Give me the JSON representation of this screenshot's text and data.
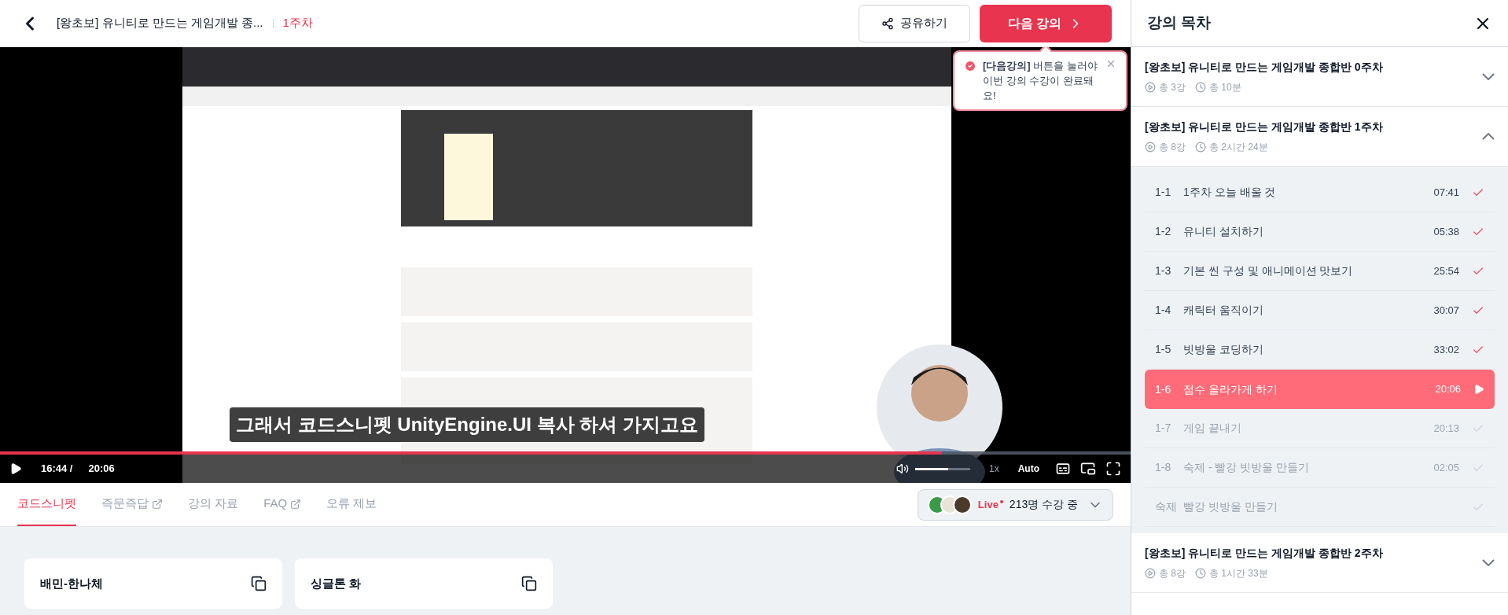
{
  "header": {
    "course_title": "[왕초보] 유니티로 만드는 게임개발 종...",
    "week": "1주차",
    "share_button": "공유하기",
    "next_button": "다음 강의"
  },
  "tooltip": {
    "message": "**[다음강의]** 버튼을 눌러야 이번 강의 수강이 완료돼요!"
  },
  "video": {
    "kind": "picture",
    "subtitle": "그래서 코드스니펫 UnityEngine.UI 복사 하셔 가지고요",
    "current_time": "16:44 /",
    "duration": "20:06",
    "level": 0.833,
    "volume": {
      "level": 0.6
    },
    "speed": "1x",
    "quality": "Auto"
  },
  "tabs": [
    {
      "label": "코드스니펫",
      "selected": true,
      "external": false
    },
    {
      "label": "즉문즉답",
      "selected": false,
      "external": true
    },
    {
      "label": "강의 자료",
      "selected": false,
      "external": false
    },
    {
      "label": "FAQ",
      "selected": false,
      "external": true
    },
    {
      "label": "오류 제보",
      "selected": false,
      "external": false
    }
  ],
  "live": {
    "badge": "Live",
    "viewers": "213명 수강 중"
  },
  "snippets": [
    {
      "title": "배민-한나체"
    },
    {
      "title": "싱글톤 화"
    }
  ],
  "sidebar": {
    "title": "강의 목차",
    "sections": [
      {
        "title": "[왕초보] 유니티로 만드는 게임개발 종합반 0주차",
        "count": "총 3강",
        "duration": "총 10분",
        "expanded": false
      },
      {
        "title": "[왕초보] 유니티로 만드는 게임개발 종합반 1주차",
        "count": "총 8강",
        "duration": "총 2시간 24분",
        "expanded": true,
        "lessons": [
          {
            "number": "1-1",
            "title": "1주차 오늘 배울 것",
            "time": "07:41",
            "watched": true,
            "selected": false
          },
          {
            "number": "1-2",
            "title": "유니티 설치하기",
            "time": "05:38",
            "watched": true,
            "selected": false
          },
          {
            "number": "1-3",
            "title": "기본 씬 구성 및 애니메이션 맛보기",
            "time": "25:54",
            "watched": true,
            "selected": false
          },
          {
            "number": "1-4",
            "title": "캐릭터 움직이기",
            "time": "30:07",
            "watched": true,
            "selected": false
          },
          {
            "number": "1-5",
            "title": "빗방울 코딩하기",
            "time": "33:02",
            "watched": true,
            "selected": false
          },
          {
            "number": "1-6",
            "title": "점수 올라가게 하기",
            "time": "20:06",
            "watched": false,
            "selected": true
          },
          {
            "number": "1-7",
            "title": "게임 끝내기",
            "time": "20:13",
            "watched": false,
            "selected": false
          },
          {
            "number": "1-8",
            "title": "숙제 - 빨강 빗방울 만들기",
            "time": "02:05",
            "watched": false,
            "selected": false
          },
          {
            "number": "숙제",
            "title": "빨강 빗방울 만들기",
            "watched": false,
            "selected": false
          }
        ]
      },
      {
        "title": "[왕초보] 유니티로 만드는 게임개발 종합반 2주차",
        "count": "총 8강",
        "duration": "총 1시간 33분",
        "expanded": false
      }
    ]
  }
}
